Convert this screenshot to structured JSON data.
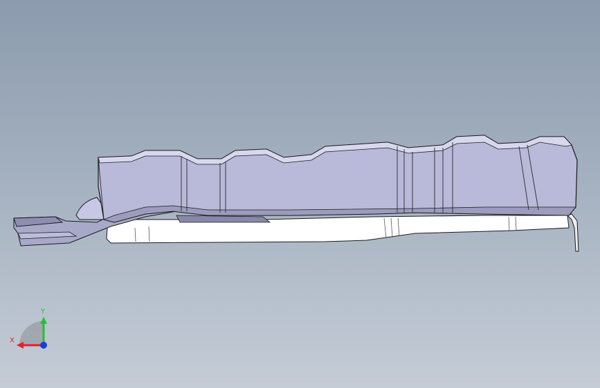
{
  "viewport": {
    "background_top": "#8c9bad",
    "background_bottom": "#c5ccd6"
  },
  "part": {
    "body_fill": "#b9b9d9",
    "body_fill_shadow": "#a6a6c8",
    "underside_fill": "#ffffff",
    "edge_color": "#1a1a1a"
  },
  "triad": {
    "x_label": "X",
    "y_label": "Y",
    "x_color": "#e8202a",
    "y_color": "#22c232",
    "z_color": "#1a3fd6"
  }
}
